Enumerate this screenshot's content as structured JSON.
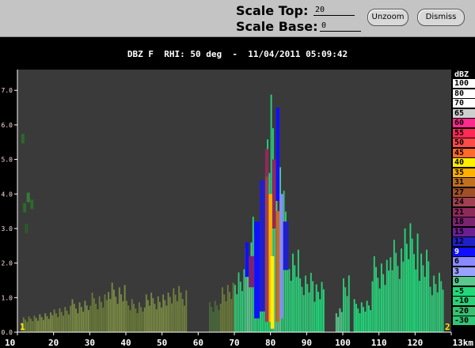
{
  "toolbar": {
    "scale_top_label": "Scale Top:",
    "scale_top_value": "20",
    "scale_base_label": "Scale Base:",
    "scale_base_value": "0",
    "unzoom_label": "Unzoom",
    "dismiss_label": "Dismiss"
  },
  "plot": {
    "title": "DBZ F  RHI: 50 deg  -  11/04/2011 05:09:42",
    "background": "#3a3a3a",
    "corner_left": "1",
    "corner_right": "2"
  },
  "chart_data": {
    "type": "heatmap",
    "title": "DBZ F  RHI: 50 deg  -  11/04/2011 05:09:42",
    "xlabel": "km",
    "ylabel": "",
    "x_tick_labels": [
      "10",
      "20",
      "30",
      "40",
      "50",
      "60",
      "70",
      "80",
      "90",
      "100",
      "110",
      "120",
      "13km"
    ],
    "x_ticks": [
      10,
      20,
      30,
      40,
      50,
      60,
      70,
      80,
      90,
      100,
      110,
      120,
      130
    ],
    "xlim": [
      10,
      130
    ],
    "y_tick_labels": [
      "0.0",
      "1.0",
      "2.0",
      "3.0",
      "4.0",
      "5.0",
      "6.0",
      "7.0"
    ],
    "y_ticks": [
      0,
      1,
      2,
      3,
      4,
      5,
      6,
      7
    ],
    "ylim": [
      0,
      7.6
    ],
    "legend_title": "dBZ",
    "legend_placement": "right",
    "colorbar": [
      {
        "label": "100",
        "color": "#ffffff",
        "text": "#000000"
      },
      {
        "label": "80",
        "color": "#ffffff",
        "text": "#000000"
      },
      {
        "label": "70",
        "color": "#ffffff",
        "text": "#000000"
      },
      {
        "label": "65",
        "color": "#cfcfcf",
        "text": "#000000"
      },
      {
        "label": "60",
        "color": "#ff2a8c",
        "text": "#000000"
      },
      {
        "label": "55",
        "color": "#ff2a55",
        "text": "#000000"
      },
      {
        "label": "50",
        "color": "#ff4a4a",
        "text": "#000000"
      },
      {
        "label": "45",
        "color": "#ff6a2a",
        "text": "#000000"
      },
      {
        "label": "40",
        "color": "#ffee00",
        "text": "#000000"
      },
      {
        "label": "35",
        "color": "#ffb000",
        "text": "#000000"
      },
      {
        "label": "31",
        "color": "#c07020",
        "text": "#000000"
      },
      {
        "label": "27",
        "color": "#a05028",
        "text": "#000000"
      },
      {
        "label": "24",
        "color": "#a04050",
        "text": "#000000"
      },
      {
        "label": "21",
        "color": "#8e2a5a",
        "text": "#000000"
      },
      {
        "label": "18",
        "color": "#7a2470",
        "text": "#000000"
      },
      {
        "label": "15",
        "color": "#6a2090",
        "text": "#000000"
      },
      {
        "label": "12",
        "color": "#2020c8",
        "text": "#000000"
      },
      {
        "label": "9",
        "color": "#1010ff",
        "text": "#ffffff"
      },
      {
        "label": "6",
        "color": "#8a8aff",
        "text": "#000000"
      },
      {
        "label": "3",
        "color": "#9aa2ff",
        "text": "#000000"
      },
      {
        "label": "0",
        "color": "#5ac88c",
        "text": "#000000"
      },
      {
        "label": "-5",
        "color": "#22d87a",
        "text": "#000000"
      },
      {
        "label": "-10",
        "color": "#2ad07a",
        "text": "#000000"
      },
      {
        "label": "-20",
        "color": "#38c070",
        "text": "#000000"
      },
      {
        "label": "-30",
        "color": "#30c878",
        "text": "#000000"
      }
    ],
    "echo_columns": [
      {
        "x0": 11,
        "x1": 15,
        "top": 0.5,
        "color": "#6a7a3a"
      },
      {
        "x0": 15,
        "x1": 20,
        "top": 0.6,
        "color": "#7a8a44"
      },
      {
        "x0": 20,
        "x1": 25,
        "top": 0.8,
        "color": "#6f7f3e"
      },
      {
        "x0": 25,
        "x1": 30,
        "top": 1.0,
        "color": "#7a8a44"
      },
      {
        "x0": 30,
        "x1": 35,
        "top": 1.2,
        "color": "#6a7a3a"
      },
      {
        "x0": 35,
        "x1": 40,
        "top": 1.5,
        "color": "#7a8a44"
      },
      {
        "x0": 40,
        "x1": 45,
        "top": 1.0,
        "color": "#6a7a3a"
      },
      {
        "x0": 45,
        "x1": 52,
        "top": 1.2,
        "color": "#7a8a44"
      },
      {
        "x0": 52,
        "x1": 57,
        "top": 1.4,
        "color": "#6f7f3e"
      },
      {
        "x0": 63,
        "x1": 66,
        "top": 1.0,
        "color": "#4a6a3a"
      },
      {
        "x0": 66,
        "x1": 70,
        "top": 1.5,
        "color": "#6a7a3a"
      },
      {
        "x0": 70,
        "x1": 73,
        "top": 2.0,
        "color": "#30c878"
      },
      {
        "x0": 73,
        "x1": 75,
        "top": 3.0,
        "color": "#5ac88c"
      },
      {
        "x0": 75,
        "x1": 77,
        "top": 3.5,
        "color": "#2ad07a"
      },
      {
        "x0": 77,
        "x1": 79,
        "top": 4.2,
        "color": "#22d87a"
      },
      {
        "x0": 79,
        "x1": 81,
        "top": 7.2,
        "color": "#2ad07a"
      },
      {
        "x0": 81,
        "x1": 83,
        "top": 5.0,
        "color": "#5ac88c"
      },
      {
        "x0": 83,
        "x1": 85,
        "top": 4.5,
        "color": "#30c878"
      },
      {
        "x0": 85,
        "x1": 88,
        "top": 2.5,
        "color": "#2ad07a"
      },
      {
        "x0": 88,
        "x1": 92,
        "top": 1.8,
        "color": "#30c878"
      },
      {
        "x0": 92,
        "x1": 95,
        "top": 1.6,
        "color": "#22d87a"
      },
      {
        "x0": 98,
        "x1": 100,
        "top": 0.8,
        "color": "#5ac88c"
      },
      {
        "x0": 100,
        "x1": 102,
        "top": 1.9,
        "color": "#30c878"
      },
      {
        "x0": 103,
        "x1": 108,
        "top": 1.0,
        "color": "#22d87a"
      },
      {
        "x0": 108,
        "x1": 113,
        "top": 2.3,
        "color": "#2ad07a"
      },
      {
        "x0": 113,
        "x1": 117,
        "top": 2.8,
        "color": "#30c878"
      },
      {
        "x0": 117,
        "x1": 121,
        "top": 3.3,
        "color": "#22d87a"
      },
      {
        "x0": 121,
        "x1": 124,
        "top": 2.5,
        "color": "#2ad07a"
      },
      {
        "x0": 124,
        "x1": 128,
        "top": 1.8,
        "color": "#30c878"
      }
    ],
    "core_cells": [
      {
        "x0": 73,
        "x1": 74,
        "y0": 1.6,
        "y1": 2.6,
        "color": "#1010ff"
      },
      {
        "x0": 74,
        "x1": 75.5,
        "y0": 1.3,
        "y1": 2.2,
        "color": "#7a2470"
      },
      {
        "x0": 75.5,
        "x1": 77,
        "y0": 0.4,
        "y1": 3.2,
        "color": "#1010ff"
      },
      {
        "x0": 77,
        "x1": 78.5,
        "y0": 0.6,
        "y1": 4.4,
        "color": "#2020c8"
      },
      {
        "x0": 78.5,
        "x1": 79.5,
        "y0": 0.3,
        "y1": 4.5,
        "color": "#a04050"
      },
      {
        "x0": 79.5,
        "x1": 80.5,
        "y0": 0.3,
        "y1": 4.0,
        "color": "#ffb000"
      },
      {
        "x0": 80,
        "x1": 81,
        "y0": 0.1,
        "y1": 2.2,
        "color": "#ffee00"
      },
      {
        "x0": 80.5,
        "x1": 81.5,
        "y0": 3.0,
        "y1": 5.0,
        "color": "#8e2a5a"
      },
      {
        "x0": 81.5,
        "x1": 82.5,
        "y0": 3.8,
        "y1": 6.5,
        "color": "#1010ff"
      },
      {
        "x0": 81.5,
        "x1": 82.5,
        "y0": 0.3,
        "y1": 3.5,
        "color": "#c07020"
      },
      {
        "x0": 82.5,
        "x1": 83.5,
        "y0": 0.4,
        "y1": 4.0,
        "color": "#8a8aff"
      },
      {
        "x0": 83.5,
        "x1": 85,
        "y0": 1.8,
        "y1": 3.2,
        "color": "#2020c8"
      },
      {
        "x0": 78.5,
        "x1": 79.5,
        "y0": 4.5,
        "y1": 5.3,
        "color": "#8e2a5a"
      }
    ],
    "scatter_noise": [
      {
        "x": 12,
        "y": 3.6,
        "color": "#2a6a2a"
      },
      {
        "x": 13,
        "y": 3.9,
        "color": "#3a7a3a"
      },
      {
        "x": 14,
        "y": 3.7,
        "color": "#2a6a2a"
      },
      {
        "x": 12.5,
        "y": 3.0,
        "color": "#2a5a2a"
      },
      {
        "x": 11.5,
        "y": 5.6,
        "color": "#2a6a2a"
      }
    ]
  }
}
